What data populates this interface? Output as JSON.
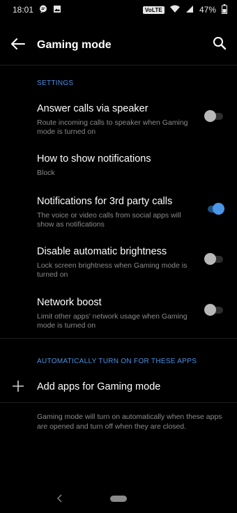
{
  "status": {
    "time": "18:01",
    "network": "VoLTE",
    "battery": "47%"
  },
  "app_bar": {
    "title": "Gaming mode"
  },
  "sections": {
    "settings_header": "SETTINGS",
    "auto_header": "AUTOMATICALLY TURN ON FOR THESE APPS"
  },
  "settings": [
    {
      "title": "Answer calls via speaker",
      "subtitle": "Route incoming calls to speaker when Gaming mode is turned on",
      "toggle": false
    },
    {
      "title": "How to show notifications",
      "subtitle": "Block"
    },
    {
      "title": "Notifications for 3rd party calls",
      "subtitle": "The voice or video calls from social apps will show as notifications",
      "toggle": true
    },
    {
      "title": "Disable automatic brightness",
      "subtitle": "Lock screen brightness when Gaming mode is turned on",
      "toggle": false
    },
    {
      "title": "Network boost",
      "subtitle": "Limit other apps' network usage when Gaming mode is turned on",
      "toggle": false
    }
  ],
  "add_apps": {
    "label": "Add apps for Gaming mode"
  },
  "footer_note": "Gaming mode will turn on automatically when these apps are opened and turn off when they are closed.",
  "colors": {
    "accent": "#4a90e2",
    "background": "#000000",
    "toggle_on": "#4a97ea",
    "toggle_off": "#b8b8b8"
  },
  "icons": [
    "back-arrow-icon",
    "search-icon",
    "plus-icon",
    "message-icon",
    "image-icon",
    "wifi-icon",
    "signal-icon",
    "battery-icon"
  ]
}
